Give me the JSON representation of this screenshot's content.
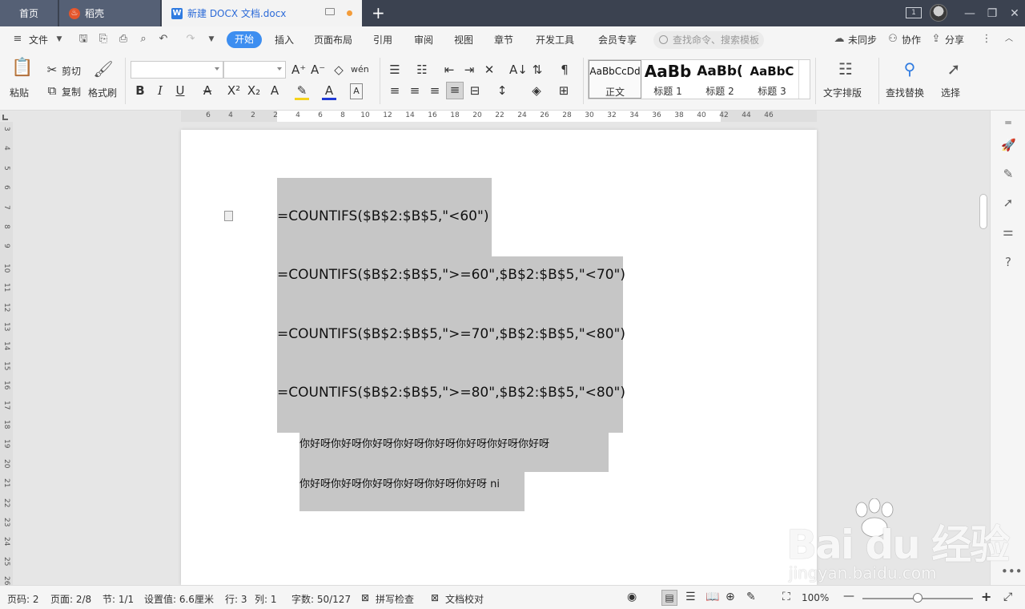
{
  "titlebar": {
    "tab_home": "首页",
    "tab_daoke": "稻壳",
    "tab_doc": "新建 DOCX 文档.docx",
    "page_badge": "1"
  },
  "menubar": {
    "file": "文件",
    "active_tab": "开始",
    "tabs": [
      "插入",
      "页面布局",
      "引用",
      "审阅",
      "视图",
      "章节",
      "开发工具",
      "会员专享"
    ],
    "search_placeholder": "查找命令、搜索模板",
    "unsynced": "未同步",
    "collab": "协作",
    "share": "分享"
  },
  "ribbon": {
    "paste": "粘贴",
    "cut": "剪切",
    "copy": "复制",
    "format_painter": "格式刷",
    "font_name": "",
    "font_size": "",
    "styles": [
      {
        "preview": "AaBbCcDd",
        "name": "正文"
      },
      {
        "preview": "AaBb",
        "name": "标题 1"
      },
      {
        "preview": "AaBb(",
        "name": "标题 2"
      },
      {
        "preview": "AaBbC",
        "name": "标题 3"
      }
    ],
    "text_layout": "文字排版",
    "find_replace": "查找替换",
    "select": "选择"
  },
  "ruler": {
    "h_ticks": [
      "6",
      "4",
      "2",
      "2",
      "4",
      "6",
      "8",
      "10",
      "12",
      "14",
      "16",
      "18",
      "20",
      "22",
      "24",
      "26",
      "28",
      "30",
      "32",
      "34",
      "36",
      "38",
      "40",
      "42",
      "44",
      "46"
    ],
    "v_ticks": [
      "3",
      "4",
      "5",
      "6",
      "7",
      "8",
      "9",
      "10",
      "11",
      "12",
      "13",
      "14",
      "15",
      "16",
      "17",
      "18",
      "19",
      "20",
      "21",
      "22",
      "23",
      "24",
      "25",
      "26"
    ]
  },
  "document": {
    "formulas": [
      "=COUNTIFS($B$2:$B$5,\"<60\")",
      "=COUNTIFS($B$2:$B$5,\">=60\",$B$2:$B$5,\"<70\")",
      "=COUNTIFS($B$2:$B$5,\">=70\",$B$2:$B$5,\"<80\")",
      "=COUNTIFS($B$2:$B$5,\">=80\",$B$2:$B$5,\"<80\")"
    ],
    "chinese_lines": [
      "你好呀你好呀你好呀你好呀你好呀你好呀你好呀你好呀",
      "你好呀你好呀你好呀你好呀你好呀你好呀 ni"
    ]
  },
  "watermark": {
    "brand": "Bai du 经验",
    "url": "jingyan.baidu.com"
  },
  "statusbar": {
    "page_num": "页码: 2",
    "pages": "页面: 2/8",
    "section": "节: 1/1",
    "setting": "设置值: 6.6厘米",
    "row": "行: 3",
    "col": "列: 1",
    "word_count": "字数: 50/127",
    "spell_check": "拼写检查",
    "doc_proof": "文档校对",
    "zoom": "100%"
  }
}
